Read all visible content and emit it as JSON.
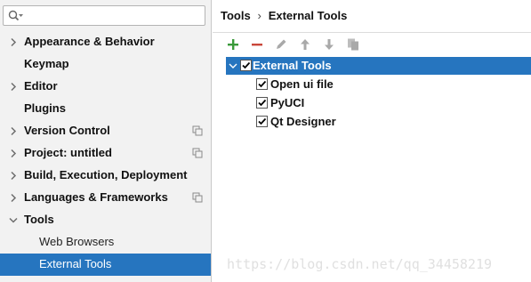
{
  "search": {
    "value": "",
    "placeholder": ""
  },
  "sidebar": {
    "items": [
      {
        "label": "Appearance & Behavior",
        "expandable": true
      },
      {
        "label": "Keymap",
        "expandable": false
      },
      {
        "label": "Editor",
        "expandable": true
      },
      {
        "label": "Plugins",
        "expandable": false
      },
      {
        "label": "Version Control",
        "expandable": true,
        "project_icon": true
      },
      {
        "label": "Project: untitled",
        "expandable": true,
        "project_icon": true
      },
      {
        "label": "Build, Execution, Deployment",
        "expandable": true
      },
      {
        "label": "Languages & Frameworks",
        "expandable": true,
        "project_icon": true
      },
      {
        "label": "Tools",
        "expandable": true,
        "expanded": true
      },
      {
        "label": "Web Browsers",
        "child": true
      },
      {
        "label": "External Tools",
        "child": true,
        "selected": true
      }
    ]
  },
  "breadcrumb": {
    "parent": "Tools",
    "separator": "›",
    "current": "External Tools"
  },
  "toolbar": {
    "buttons": [
      "add-icon",
      "remove-icon",
      "edit-icon",
      "move-up-icon",
      "move-down-icon",
      "copy-icon"
    ],
    "colors": {
      "add": "#3a9a3a",
      "remove": "#c9463a",
      "disabled": "#a9a9a9"
    }
  },
  "tools_tree": {
    "group": {
      "label": "External Tools",
      "checked": true,
      "expanded": true
    },
    "tools": [
      {
        "label": "Open ui file",
        "checked": true
      },
      {
        "label": "PyUCI",
        "checked": true
      },
      {
        "label": "Qt Designer",
        "checked": true
      }
    ]
  },
  "watermark": {
    "text": "https://blog.csdn.net/qq_34458219"
  },
  "colors": {
    "selection": "#2675bf",
    "sidebar_bg": "#f2f2f2"
  }
}
